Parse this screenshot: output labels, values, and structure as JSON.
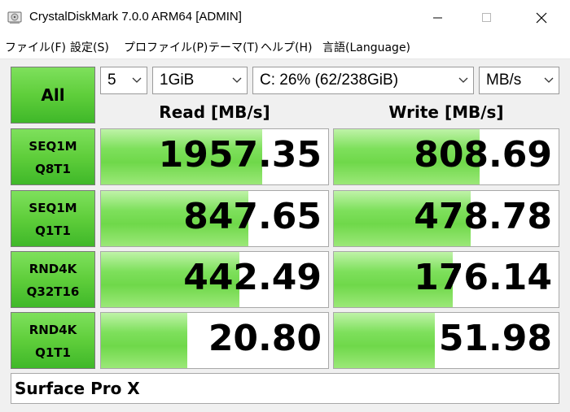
{
  "window": {
    "title": "CrystalDiskMark 7.0.0 ARM64 [ADMIN]"
  },
  "menu": [
    "ファイル(F)",
    "設定(S)",
    "プロファイル(P)",
    "テーマ(T)",
    "ヘルプ(H)",
    "言語(Language)"
  ],
  "controls": {
    "all_label": "All",
    "count": "5",
    "size": "1GiB",
    "drive": "C: 26% (62/238GiB)",
    "unit": "MB/s"
  },
  "columns": {
    "read": "Read [MB/s]",
    "write": "Write [MB/s]"
  },
  "tests": [
    {
      "line1": "SEQ1M",
      "line2": "Q8T1",
      "read": "1957.35",
      "write": "808.69",
      "read_fill": 0.71,
      "write_fill": 0.65
    },
    {
      "line1": "SEQ1M",
      "line2": "Q1T1",
      "read": "847.65",
      "write": "478.78",
      "read_fill": 0.65,
      "write_fill": 0.61
    },
    {
      "line1": "RND4K",
      "line2": "Q32T16",
      "read": "442.49",
      "write": "176.14",
      "read_fill": 0.61,
      "write_fill": 0.53
    },
    {
      "line1": "RND4K",
      "line2": "Q1T1",
      "read": "20.80",
      "write": "51.98",
      "read_fill": 0.38,
      "write_fill": 0.45
    }
  ],
  "comment": "Surface Pro X",
  "colors": {
    "button_green": "#5fce3b",
    "bar_green": "#7ee05c"
  }
}
